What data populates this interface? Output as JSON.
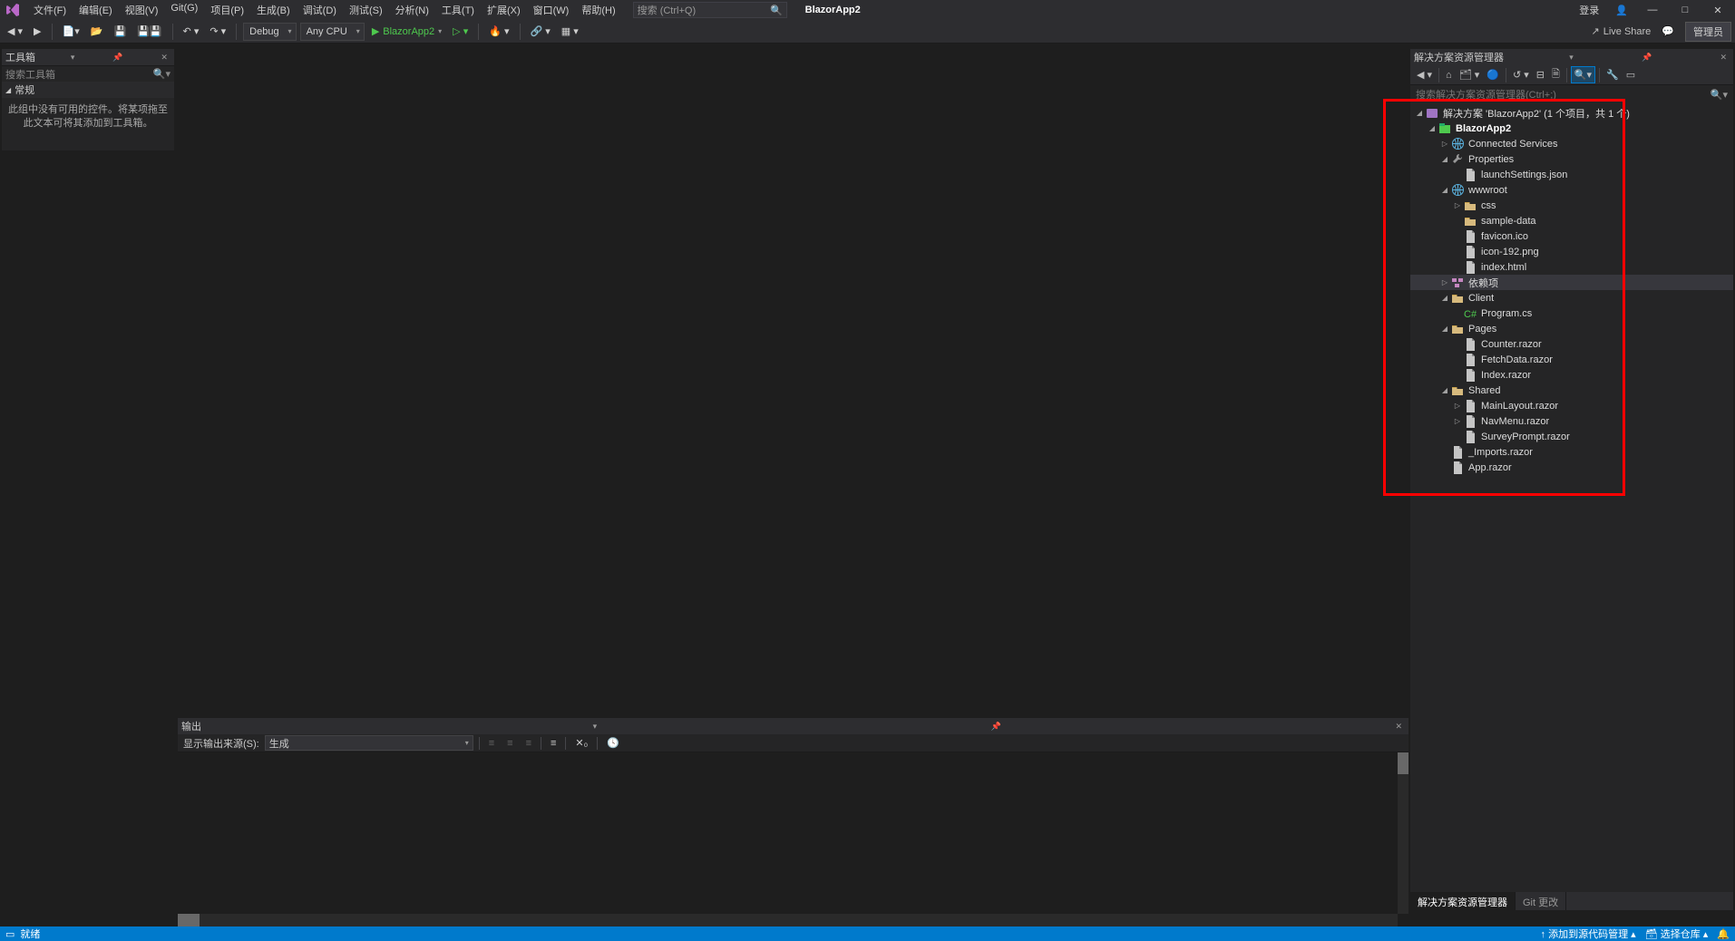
{
  "titlebar": {
    "menus": [
      "文件(F)",
      "编辑(E)",
      "视图(V)",
      "Git(G)",
      "项目(P)",
      "生成(B)",
      "调试(D)",
      "测试(S)",
      "分析(N)",
      "工具(T)",
      "扩展(X)",
      "窗口(W)",
      "帮助(H)"
    ],
    "search_placeholder": "搜索 (Ctrl+Q)",
    "app_name": "BlazorApp2",
    "login": "登录",
    "win": {
      "min": "—",
      "max": "□",
      "close": "✕"
    }
  },
  "toolbar": {
    "config": "Debug",
    "platform": "Any CPU",
    "run_target": "BlazorApp2",
    "live_share": "Live Share",
    "admin": "管理员"
  },
  "toolbox": {
    "title": "工具箱",
    "search_placeholder": "搜索工具箱",
    "group": "常规",
    "empty": "此组中没有可用的控件。将某项拖至此文本可将其添加到工具箱。"
  },
  "output": {
    "title": "输出",
    "source_label": "显示输出来源(S):",
    "source_value": "生成"
  },
  "solution": {
    "title": "解决方案资源管理器",
    "search_placeholder": "搜索解决方案资源管理器(Ctrl+;)",
    "tabs": {
      "active": "解决方案资源管理器",
      "other": "Git 更改"
    },
    "tree": [
      {
        "d": 0,
        "ar": "open",
        "icon": "sol",
        "label": "解决方案 'BlazorApp2' (1 个项目，共 1 个)"
      },
      {
        "d": 1,
        "ar": "open",
        "icon": "proj",
        "label": "BlazorApp2",
        "bold": true
      },
      {
        "d": 2,
        "ar": "closed",
        "icon": "globe",
        "label": "Connected Services"
      },
      {
        "d": 2,
        "ar": "open",
        "icon": "wrench",
        "label": "Properties"
      },
      {
        "d": 3,
        "ar": "none",
        "icon": "file",
        "label": "launchSettings.json"
      },
      {
        "d": 2,
        "ar": "open",
        "icon": "globe",
        "label": "wwwroot"
      },
      {
        "d": 3,
        "ar": "closed",
        "icon": "folder",
        "label": "css"
      },
      {
        "d": 3,
        "ar": "none",
        "icon": "folder",
        "label": "sample-data"
      },
      {
        "d": 3,
        "ar": "none",
        "icon": "file",
        "label": "favicon.ico"
      },
      {
        "d": 3,
        "ar": "none",
        "icon": "file",
        "label": "icon-192.png"
      },
      {
        "d": 3,
        "ar": "none",
        "icon": "file",
        "label": "index.html"
      },
      {
        "d": 2,
        "ar": "closed",
        "icon": "dep",
        "label": "依赖项",
        "sel": true
      },
      {
        "d": 2,
        "ar": "open",
        "icon": "folder",
        "label": "Client"
      },
      {
        "d": 3,
        "ar": "none",
        "icon": "cs",
        "label": "Program.cs"
      },
      {
        "d": 2,
        "ar": "open",
        "icon": "folder",
        "label": "Pages"
      },
      {
        "d": 3,
        "ar": "none",
        "icon": "file",
        "label": "Counter.razor"
      },
      {
        "d": 3,
        "ar": "none",
        "icon": "file",
        "label": "FetchData.razor"
      },
      {
        "d": 3,
        "ar": "none",
        "icon": "file",
        "label": "Index.razor"
      },
      {
        "d": 2,
        "ar": "open",
        "icon": "folder",
        "label": "Shared"
      },
      {
        "d": 3,
        "ar": "closed",
        "icon": "file",
        "label": "MainLayout.razor"
      },
      {
        "d": 3,
        "ar": "closed",
        "icon": "file",
        "label": "NavMenu.razor"
      },
      {
        "d": 3,
        "ar": "none",
        "icon": "file",
        "label": "SurveyPrompt.razor"
      },
      {
        "d": 2,
        "ar": "none",
        "icon": "file",
        "label": "_Imports.razor"
      },
      {
        "d": 2,
        "ar": "none",
        "icon": "file",
        "label": "App.razor"
      }
    ]
  },
  "statusbar": {
    "ready": "就绪",
    "add_src": "添加到源代码管理",
    "select_repo": "选择仓库"
  }
}
